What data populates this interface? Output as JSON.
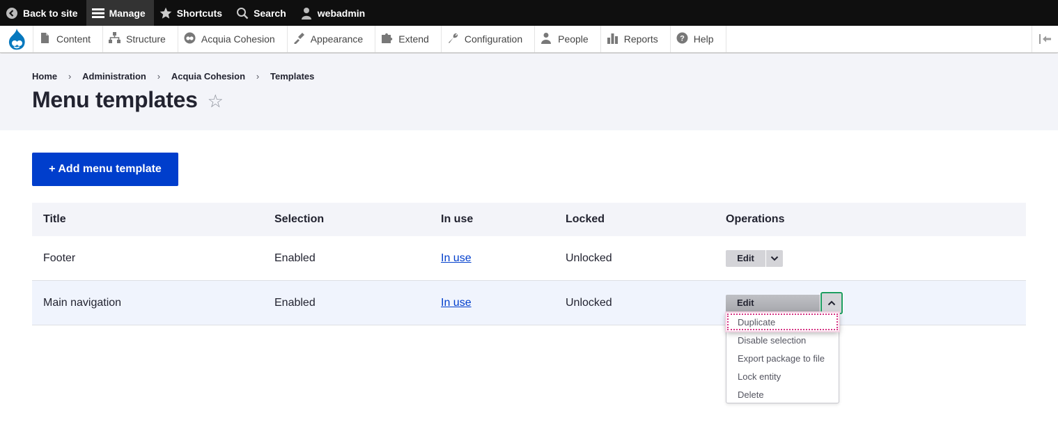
{
  "toolbar": {
    "back_to_site": "Back to site",
    "manage": "Manage",
    "shortcuts": "Shortcuts",
    "search": "Search",
    "user": "webadmin"
  },
  "admin_menu": {
    "items": [
      {
        "label": "Content",
        "icon": "page-icon"
      },
      {
        "label": "Structure",
        "icon": "structure-icon"
      },
      {
        "label": "Acquia Cohesion",
        "icon": "cohesion-icon"
      },
      {
        "label": "Appearance",
        "icon": "paintbrush-icon"
      },
      {
        "label": "Extend",
        "icon": "puzzle-icon"
      },
      {
        "label": "Configuration",
        "icon": "wrench-icon"
      },
      {
        "label": "People",
        "icon": "people-icon"
      },
      {
        "label": "Reports",
        "icon": "bar-chart-icon"
      },
      {
        "label": "Help",
        "icon": "help-icon"
      }
    ]
  },
  "breadcrumb": [
    "Home",
    "Administration",
    "Acquia Cohesion",
    "Templates"
  ],
  "page": {
    "title": "Menu templates",
    "star": "☆"
  },
  "add_button": "+ Add menu template",
  "table": {
    "headers": [
      "Title",
      "Selection",
      "In use",
      "Locked",
      "Operations"
    ],
    "rows": [
      {
        "title": "Footer",
        "selection": "Enabled",
        "in_use": "In use",
        "locked": "Unlocked",
        "edit": "Edit"
      },
      {
        "title": "Main navigation",
        "selection": "Enabled",
        "in_use": "In use",
        "locked": "Unlocked",
        "edit": "Edit"
      }
    ]
  },
  "dropdown_menu": [
    "Duplicate",
    "Disable selection",
    "Export package to file",
    "Lock entity",
    "Delete"
  ],
  "colors": {
    "toolbar_bg": "#0f0f0f",
    "primary_button": "#003ecc",
    "header_bg": "#f3f4f9",
    "link": "#003ecc",
    "focus_ring": "#d63384",
    "toggle_focus": "#1e9e62"
  }
}
